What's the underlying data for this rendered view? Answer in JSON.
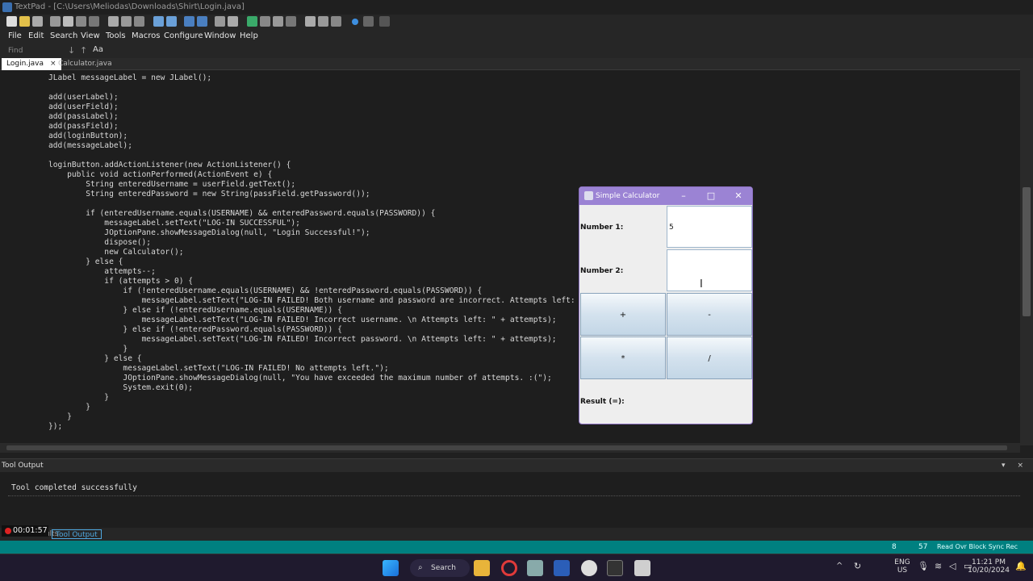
{
  "window": {
    "title": "TextPad - [C:\\Users\\Meliodas\\Downloads\\Shirt\\Login.java]"
  },
  "menu": [
    "File",
    "Edit",
    "Search",
    "View",
    "Tools",
    "Macros",
    "Configure",
    "Window",
    "Help"
  ],
  "findbar": {
    "placeholder": "Find increment...",
    "case_label": "Aa"
  },
  "tabs": [
    {
      "label": "Login.java",
      "active": true
    },
    {
      "label": "Calculator.java",
      "active": false
    }
  ],
  "code_lines": [
    "JLabel messageLabel = new JLabel();",
    "",
    "add(userLabel);",
    "add(userField);",
    "add(passLabel);",
    "add(passField);",
    "add(loginButton);",
    "add(messageLabel);",
    "",
    "loginButton.addActionListener(new ActionListener() {",
    "    public void actionPerformed(ActionEvent e) {",
    "        String enteredUsername = userField.getText();",
    "        String enteredPassword = new String(passField.getPassword());",
    "",
    "        if (enteredUsername.equals(USERNAME) && enteredPassword.equals(PASSWORD)) {",
    "            messageLabel.setText(\"LOG-IN SUCCESSFUL\");",
    "            JOptionPane.showMessageDialog(null, \"Login Successful!\");",
    "            dispose();",
    "            new Calculator();",
    "        } else {",
    "            attempts--;",
    "            if (attempts > 0) {",
    "                if (!enteredUsername.equals(USERNAME) && !enteredPassword.equals(PASSWORD)) {",
    "                    messageLabel.setText(\"LOG-IN FAILED! Both username and password are incorrect. Attempts left: \" + at",
    "                } else if (!enteredUsername.equals(USERNAME)) {",
    "                    messageLabel.setText(\"LOG-IN FAILED! Incorrect username. \\n Attempts left: \" + attempts);",
    "                } else if (!enteredPassword.equals(PASSWORD)) {",
    "                    messageLabel.setText(\"LOG-IN FAILED! Incorrect password. \\n Attempts left: \" + attempts);",
    "                }",
    "            } else {",
    "                messageLabel.setText(\"LOG-IN FAILED! No attempts left.\");",
    "                JOptionPane.showMessageDialog(null, \"You have exceeded the maximum number of attempts. :(\");",
    "                System.exit(0);",
    "            }",
    "        }",
    "    }",
    "});"
  ],
  "tool_output": {
    "header": "Tool Output",
    "text": "Tool completed successfully"
  },
  "bottom_tabs": [
    "Search Results",
    "Tool Output"
  ],
  "recorder": {
    "time": "00:01:57"
  },
  "statusbar": {
    "line": "8",
    "col": "57",
    "flags": "Read Ovr Block Sync Rec Caps"
  },
  "calculator": {
    "title": "Simple Calculator",
    "number1_label": "Number 1:",
    "number1_value": "5",
    "number2_label": "Number 2:",
    "number2_value": "",
    "buttons": [
      "+",
      "-",
      "*",
      "/"
    ],
    "result_label": "Result (=):"
  },
  "taskbar": {
    "search_label": "Search",
    "lang": "ENG",
    "region": "US",
    "time": "11:21 PM",
    "date": "10/20/2024"
  },
  "colors": {
    "statusbar": "#008080",
    "calc_title": "#9b83d4",
    "taskbar": "#1f1a2e"
  }
}
